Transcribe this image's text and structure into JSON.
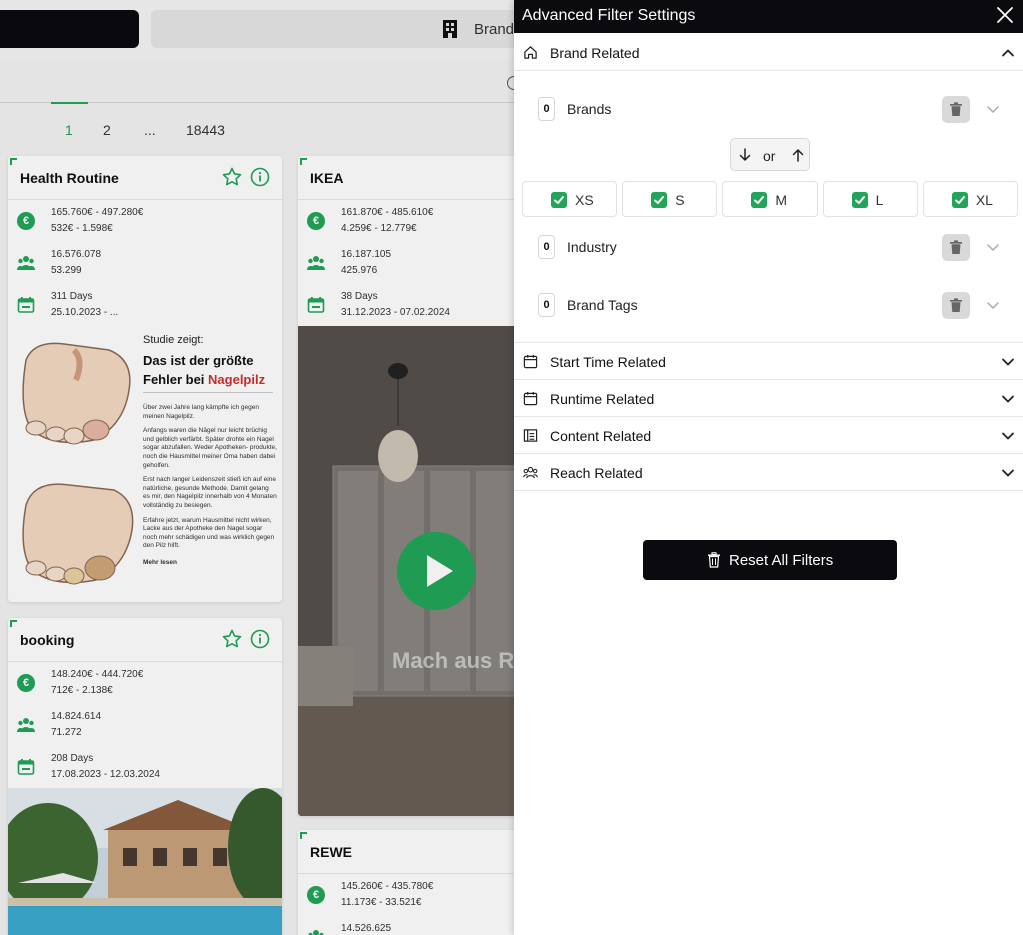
{
  "background": {
    "brand_pill_label": "Brand",
    "pager": {
      "p1": "1",
      "p2": "2",
      "dots": "...",
      "last": "18443"
    },
    "cards": {
      "health": {
        "title": "Health Routine",
        "spend_1": "165.760€ - 497.280€",
        "spend_2": "532€ - 1.598€",
        "reach_1": "16.576.078",
        "reach_2": "53.299",
        "days_1": "311 Days",
        "days_2": "25.10.2023 - ...",
        "ad": {
          "intro": "Studie zeigt:",
          "headline_1": "Das ist der größte",
          "headline_2a": "Fehler bei ",
          "headline_2b": "Nagelpilz",
          "p1": "Über zwei Jahre lang kämpfte ich gegen meinen Nagelpilz.",
          "p2": "Anfangs waren die Nägel nur leicht brüchig und gelblich verfärbt. Später drohte ein Nagel sogar abzufallen. Weder Apotheken- produkte, noch die Hausmittel meiner Oma haben dabei geholfen.",
          "p3": "Erst nach langer Leidenszeit stieß ich auf eine natürliche, gesunde Methode. Damit gelang es mir, den Nagelpilz innerhalb von 4 Monaten vollständig zu besiegen.",
          "p4": "Erfahre jetzt, warum Hausmittel nicht wirken, Lacke aus der Apotheke den Nagel sogar noch mehr schädigen und was wirklich gegen den Pilz hilft.",
          "more": "Mehr lesen"
        }
      },
      "ikea": {
        "title": "IKEA",
        "spend_1": "161.870€ - 485.610€",
        "spend_2": "4.259€ - 12.779€",
        "reach_1": "16.187.105",
        "reach_2": "425.976",
        "days_1": "38 Days",
        "days_2": "31.12.2023 - 07.02.2024",
        "video_text": "Mach aus R"
      },
      "booking": {
        "title": "booking",
        "spend_1": "148.240€ - 444.720€",
        "spend_2": "712€ - 2.138€",
        "reach_1": "14.824.614",
        "reach_2": "71.272",
        "days_1": "208 Days",
        "days_2": "17.08.2023 - 12.03.2024"
      },
      "rewe": {
        "title": "REWE",
        "spend_1": "145.260€ - 435.780€",
        "spend_2": "11.173€ - 33.521€",
        "reach_1": "14.526.625"
      }
    }
  },
  "panel": {
    "title": "Advanced Filter Settings",
    "sections": {
      "brand": "Brand Related",
      "start_time": "Start Time Related",
      "runtime": "Runtime Related",
      "content": "Content Related",
      "reach": "Reach Related"
    },
    "filters": {
      "brands": {
        "count": "0",
        "label": "Brands"
      },
      "industry": {
        "count": "0",
        "label": "Industry"
      },
      "brand_tags": {
        "count": "0",
        "label": "Brand Tags"
      }
    },
    "logic_toggle": "or",
    "sizes": [
      "XS",
      "S",
      "M",
      "L",
      "XL"
    ],
    "reset_label": "Reset All Filters"
  },
  "colors": {
    "accent": "#22a55a",
    "dark": "#0b0b0f",
    "nagelpilz_red": "#d32f2f"
  },
  "icons": [
    "building-icon",
    "star-icon",
    "info-icon",
    "euro-icon",
    "people-icon",
    "calendar-icon",
    "play-icon",
    "close-icon",
    "home-icon",
    "chevron-up-icon",
    "chevron-down-icon",
    "trash-icon",
    "arrow-down-icon",
    "arrow-up-icon",
    "checkbox-icon",
    "content-icon",
    "users-icon"
  ]
}
